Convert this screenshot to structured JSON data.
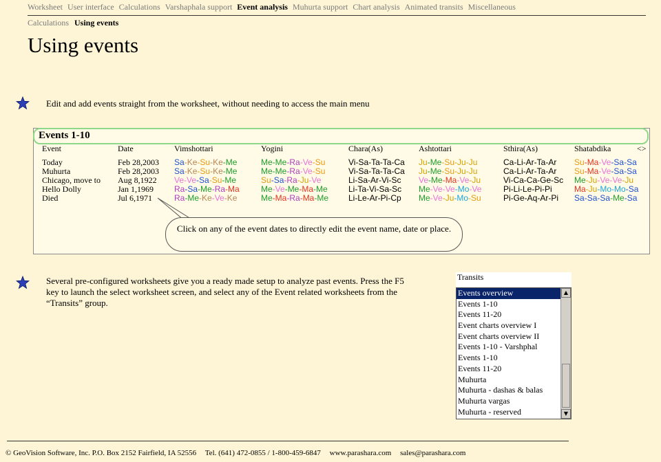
{
  "nav": {
    "items": [
      "Worksheet",
      "User interface",
      "Calculations",
      "Varshaphala support",
      "Event analysis",
      "Muhurta support",
      "Chart analysis",
      "Animated transits",
      "Miscellaneous"
    ],
    "active": 4
  },
  "subnav": {
    "items": [
      "Calculations",
      "Using events"
    ],
    "active": 1
  },
  "page_title": "Using events",
  "feature1": "Edit and add events straight from the worksheet, without needing to access the main menu",
  "feature2": "Several pre-configured worksheets give you a ready made setup to analyze past events. Press the F5 key to launch the select worksheet screen, and select any of the Event related worksheets from the “Transits” group.",
  "events_panel": {
    "title": "Events 1-10",
    "headers": [
      "Event",
      "Date",
      "Vimshottari",
      "Yogini",
      "Chara(As)",
      "Ashtottari",
      "Sthira(As)",
      "Shatabdika"
    ],
    "scroll_label": "<>",
    "rows": [
      {
        "event": "Today",
        "date": "Feb 28,2003",
        "dashas": [
          "Sa-Ke-Su-Ke-Me",
          "Me-Me-Ra-Ve-Su",
          "Vi-Sa-Ta-Ta-Ca",
          "Ju-Me-Su-Ju-Ju",
          "Ca-Li-Ar-Ta-Ar",
          "Su-Ma-Ve-Sa-Sa"
        ]
      },
      {
        "event": "Muhurta",
        "date": "Feb 28,2003",
        "dashas": [
          "Sa-Ke-Su-Ke-Me",
          "Me-Me-Ra-Ve-Su",
          "Vi-Sa-Ta-Ta-Ca",
          "Ju-Me-Su-Ju-Ju",
          "Ca-Li-Ar-Ta-Ar",
          "Su-Ma-Ve-Sa-Sa"
        ]
      },
      {
        "event": "Chicago, move to",
        "date": "Aug 8,1922",
        "dashas": [
          "Ve-Ve-Sa-Su-Me",
          "Su-Sa-Ra-Ju-Ve",
          "Li-Sa-Ar-Vi-Sc",
          "Ve-Me-Ma-Ve-Ju",
          "Vi-Ca-Ca-Ge-Sc",
          "Me-Ju-Ve-Ve-Ju"
        ]
      },
      {
        "event": "Hello Dolly",
        "date": "Jan 1,1969",
        "dashas": [
          "Ra-Sa-Me-Ra-Ma",
          "Me-Ve-Me-Ma-Me",
          "Li-Ta-Vi-Sa-Sc",
          "Me-Ve-Ve-Mo-Ve",
          "Pi-Li-Le-Pi-Pi",
          "Ma-Ju-Mo-Mo-Sa"
        ]
      },
      {
        "event": "Died",
        "date": "Jul 6,1971",
        "dashas": [
          "Ra-Me-Ke-Ve-Ke",
          "Me-Ma-Ra-Ma-Me",
          "Li-Le-Ar-Pi-Cp",
          "Me-Ve-Ju-Mo-Su",
          "Pi-Ge-Aq-Ar-Pi",
          "Sa-Sa-Sa-Me-Sa"
        ]
      }
    ],
    "callout": "Click on any of the event dates to directly edit the event name, date or place."
  },
  "planet_colors": {
    "Sa": "#1f4fd0",
    "Ke": "#b98555",
    "Su": "#e69a10",
    "Me": "#1e9e2a",
    "Ra": "#b03cc0",
    "Ve": "#e871d8",
    "Ju": "#d4a000",
    "Mo": "#1ca6d8",
    "Ma": "#e2331f"
  },
  "chara_color": "#000000",
  "transits_list": {
    "title": "Transits",
    "selected": 0,
    "items": [
      "Events overview",
      "Events 1-10",
      "Events 11-20",
      "Event charts overview I",
      "Event charts overview II",
      "Events 1-10 - Varshphal",
      "Events 1-10",
      "Events 11-20",
      "Muhurta",
      "Muhurta - dashas & balas",
      "Muhurta vargas",
      "Muhurta - reserved"
    ]
  },
  "footer": {
    "company": "© GeoVision Software, Inc. P.O. Box 2152 Fairfield, IA 52556",
    "tel": "Tel. (641) 472-0855 / 1-800-459-6847",
    "web": "www.parashara.com",
    "email": "sales@parashara.com"
  }
}
